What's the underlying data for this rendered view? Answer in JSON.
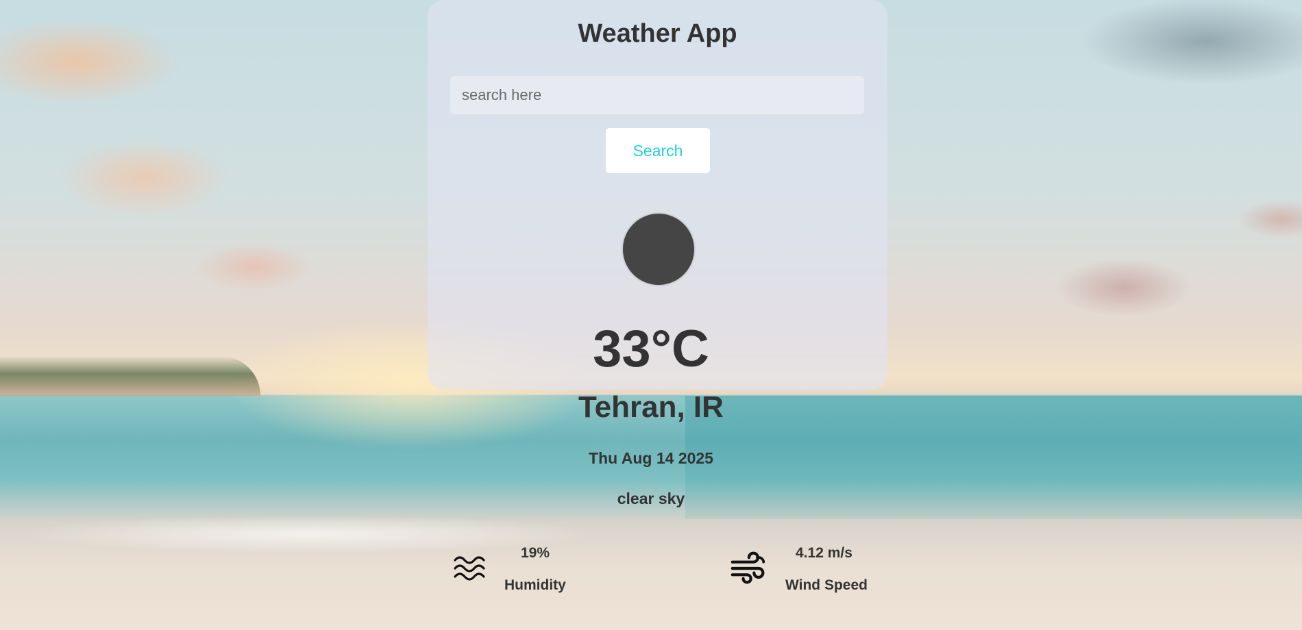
{
  "app": {
    "title": "Weather App"
  },
  "search": {
    "placeholder": "search here",
    "value": "",
    "button_label": "Search"
  },
  "weather": {
    "icon": "weather-condition-icon",
    "temperature": "33°C",
    "location": "Tehran, IR",
    "date": "Thu Aug 14 2025",
    "description": "clear sky"
  },
  "metrics": {
    "humidity": {
      "value": "19%",
      "label": "Humidity",
      "icon": "humidity-waves-icon"
    },
    "wind": {
      "value": "4.12 m/s",
      "label": "Wind Speed",
      "icon": "wind-icon"
    }
  },
  "colors": {
    "button_text": "#1ad6d6",
    "text": "#333333",
    "icon_circle": "#454545"
  }
}
